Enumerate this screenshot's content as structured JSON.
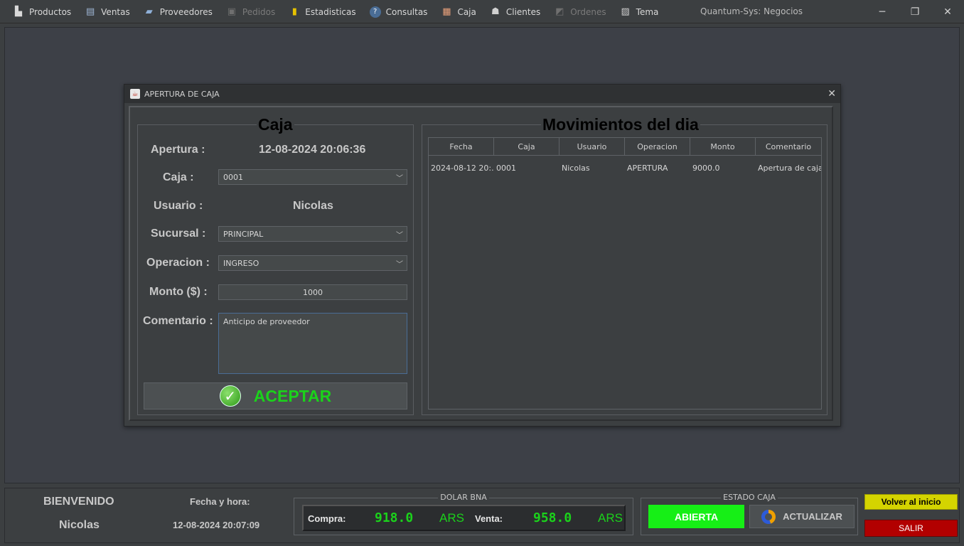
{
  "menubar": {
    "items": [
      {
        "label": "Productos",
        "icon": "products-icon",
        "enabled": true
      },
      {
        "label": "Ventas",
        "icon": "sales-icon",
        "enabled": true
      },
      {
        "label": "Proveedores",
        "icon": "suppliers-icon",
        "enabled": true
      },
      {
        "label": "Pedidos",
        "icon": "orders-icon",
        "enabled": false
      },
      {
        "label": "Estadisticas",
        "icon": "bar-chart-icon",
        "enabled": true
      },
      {
        "label": "Consultas",
        "icon": "help-icon",
        "enabled": true
      },
      {
        "label": "Caja",
        "icon": "cash-box-icon",
        "enabled": true
      },
      {
        "label": "Clientes",
        "icon": "clients-icon",
        "enabled": true
      },
      {
        "label": "Ordenes",
        "icon": "drill-icon",
        "enabled": false
      },
      {
        "label": "Tema",
        "icon": "theme-icon",
        "enabled": true
      }
    ],
    "app_title": "Quantum-Sys: Negocios"
  },
  "dialog": {
    "title": "APERTURA DE CAJA",
    "caja_panel": {
      "title": "Caja",
      "apertura_label": "Apertura :",
      "apertura_value": "12-08-2024 20:06:36",
      "caja_label": "Caja :",
      "caja_value": "0001",
      "usuario_label": "Usuario :",
      "usuario_value": "Nicolas",
      "sucursal_label": "Sucursal :",
      "sucursal_value": "PRINCIPAL",
      "operacion_label": "Operacion :",
      "operacion_value": "INGRESO",
      "monto_label": "Monto ($) :",
      "monto_value": "1000",
      "comentario_label": "Comentario :",
      "comentario_value": "Anticipo de proveedor",
      "aceptar_label": "ACEPTAR"
    },
    "movimientos_panel": {
      "title": "Movimientos del dia",
      "columns": [
        "Fecha",
        "Caja",
        "Usuario",
        "Operacion",
        "Monto",
        "Comentario"
      ],
      "rows": [
        [
          "2024-08-12 20:...",
          "0001",
          "Nicolas",
          "APERTURA",
          "9000.0",
          "Apertura de caja"
        ]
      ]
    }
  },
  "statusbar": {
    "bienvenido_label": "BIENVENIDO",
    "user": "Nicolas",
    "fecha_hora_label": "Fecha y hora:",
    "fecha_hora_value": "12-08-2024 20:07:09",
    "dolar": {
      "title": "DOLAR BNA",
      "compra_label": "Compra:",
      "compra_value": "918.0",
      "compra_currency": "ARS",
      "venta_label": "Venta:",
      "venta_value": "958.0",
      "venta_currency": "ARS"
    },
    "estado": {
      "title": "ESTADO CAJA",
      "status": "ABIERTA",
      "actualizar_label": "ACTUALIZAR"
    },
    "volver_label": "Volver al inicio",
    "salir_label": "SALIR"
  },
  "colors": {
    "accent_green": "#1bd21b",
    "status_open": "#16ef16",
    "volver_bg": "#d4d400",
    "salir_bg": "#b20000"
  }
}
